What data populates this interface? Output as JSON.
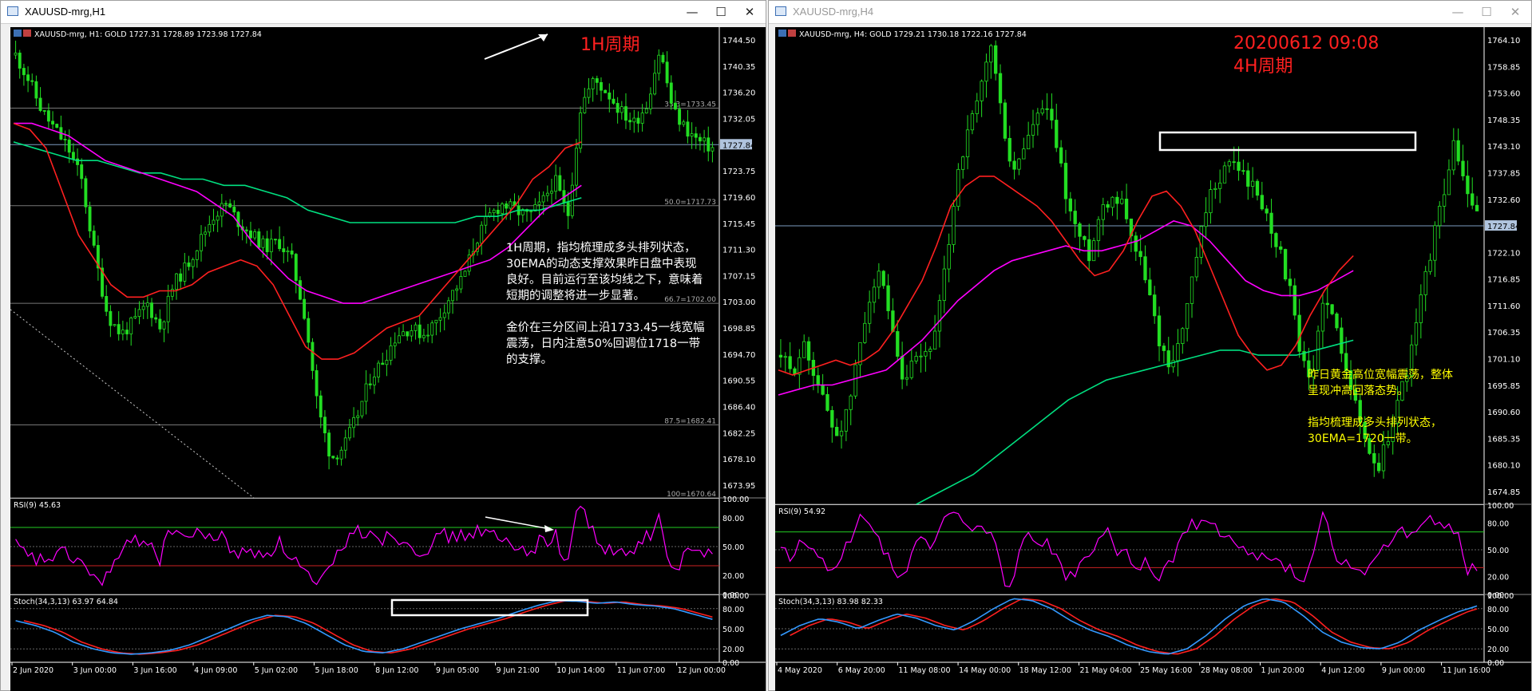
{
  "left_window": {
    "title": "XAUUSD-mrg,H1",
    "info_line": "XAUUSD-mrg, H1:  GOLD   1727.31  1728.89  1723.98  1727.84",
    "annotation_period": "1H周期",
    "comment_lines": [
      "1H周期，指均梳理成多头排列状态，",
      "30EMA的动态支撑效果昨日盘中表现",
      "良好。目前运行至该均线之下，意味着",
      "短期的调整将进一步显著。",
      "",
      "金价在三分区间上沿1733.45一线宽幅",
      "震荡，日内注意50%回调位1718一带",
      "的支撑。"
    ],
    "price_ticks": [
      "1744.50",
      "1740.35",
      "1736.20",
      "1732.05",
      "1727.84",
      "1723.75",
      "1719.60",
      "1715.45",
      "1711.30",
      "1707.15",
      "1703.00",
      "1698.85",
      "1694.70",
      "1690.55",
      "1686.40",
      "1682.25",
      "1678.10",
      "1673.95"
    ],
    "current_price": "1727.84",
    "fib_labels": [
      "33.3=1733.45",
      "50.0=1717.73",
      "66.7=1702.00",
      "87.5=1682.41",
      "100=1670.64"
    ],
    "rsi_label": "RSI(9) 45.63",
    "rsi_ticks": [
      "100.00",
      "80.00",
      "50.00",
      "20.00",
      "0.00"
    ],
    "stoch_label": "Stoch(34,3,13) 63.97 64.84",
    "stoch_ticks": [
      "100.00",
      "80.00",
      "50.00",
      "20.00",
      "0.00"
    ],
    "time_ticks": [
      "2 Jun 2020",
      "3 Jun 00:00",
      "3 Jun 16:00",
      "4 Jun 09:00",
      "5 Jun 02:00",
      "5 Jun 18:00",
      "8 Jun 12:00",
      "9 Jun 05:00",
      "9 Jun 21:00",
      "10 Jun 14:00",
      "11 Jun 07:00",
      "12 Jun 00:00"
    ]
  },
  "right_window": {
    "title": "XAUUSD-mrg,H4",
    "info_line": "XAUUSD-mrg, H4:  GOLD   1729.21  1730.18  1722.16  1727.84",
    "annotation_date": "20200612 09:08",
    "annotation_period": "4H周期",
    "comment_lines": [
      "昨日黄金高位宽幅震荡，整体",
      "呈现冲高回落态势。",
      "",
      "指均梳理成多头排列状态，",
      "30EMA=1720一带。"
    ],
    "price_ticks": [
      "1764.10",
      "1758.85",
      "1753.60",
      "1748.35",
      "1743.10",
      "1737.85",
      "1732.60",
      "1727.84",
      "1722.10",
      "1716.85",
      "1711.60",
      "1706.35",
      "1701.10",
      "1695.85",
      "1690.60",
      "1685.35",
      "1680.10",
      "1674.85"
    ],
    "current_price": "1727.84",
    "rsi_label": "RSI(9) 54.92",
    "rsi_ticks": [
      "100.00",
      "80.00",
      "50.00",
      "20.00",
      "0.00"
    ],
    "stoch_label": "Stoch(34,3,13) 83.98 82.33",
    "stoch_ticks": [
      "100.00",
      "80.00",
      "50.00",
      "20.00",
      "0.00"
    ],
    "time_ticks": [
      "4 May 2020",
      "6 May 20:00",
      "11 May 08:00",
      "14 May 00:00",
      "18 May 12:00",
      "21 May 04:00",
      "25 May 16:00",
      "28 May 08:00",
      "1 Jun 20:00",
      "4 Jun 12:00",
      "9 Jun 00:00",
      "11 Jun 16:00"
    ]
  },
  "buttons": {
    "minimize": "—",
    "maximize": "☐",
    "close": "✕"
  },
  "colors": {
    "bull": "#22dd22",
    "bear": "#22dd22",
    "ema_red": "#ff2020",
    "ema_magenta": "#ff00ff",
    "ema_green": "#00e080",
    "rsi": "#ff00ff",
    "stoch_main": "#3399ff",
    "stoch_signal": "#ff2020",
    "annot_red": "#ff2020",
    "annot_yellow": "#ffff00"
  },
  "chart_data": [
    {
      "type": "candlestick",
      "title": "XAUUSD-mrg,H1",
      "symbol": "XAUUSD-mrg",
      "timeframe": "H1",
      "ohlc_last": {
        "open": 1727.31,
        "high": 1728.89,
        "low": 1723.98,
        "close": 1727.84
      },
      "ylim": [
        1670.64,
        1746.5
      ],
      "close_path": [
        1742,
        1738,
        1733,
        1730,
        1727,
        1722,
        1710,
        1700,
        1697,
        1699,
        1702,
        1698,
        1705,
        1708,
        1712,
        1716,
        1718,
        1715,
        1713,
        1711,
        1712,
        1709,
        1700,
        1685,
        1677,
        1679,
        1684,
        1690,
        1693,
        1697,
        1698,
        1697,
        1699,
        1703,
        1706,
        1712,
        1716,
        1718,
        1717,
        1716,
        1718,
        1722,
        1716,
        1734,
        1738,
        1736,
        1733,
        1731,
        1734,
        1743,
        1733,
        1730,
        1728,
        1727
      ],
      "ema_red": [
        1731,
        1730,
        1727,
        1720,
        1713,
        1709,
        1705,
        1703,
        1703,
        1704,
        1704,
        1705,
        1707,
        1708,
        1709,
        1708,
        1705,
        1700,
        1695,
        1693,
        1693,
        1694,
        1696,
        1698,
        1699,
        1700,
        1703,
        1706,
        1709,
        1712,
        1715,
        1718,
        1722,
        1724,
        1727,
        1728
      ],
      "ema_magenta": [
        1731,
        1731,
        1730,
        1729,
        1727,
        1725,
        1724,
        1723,
        1722,
        1721,
        1720,
        1718,
        1716,
        1712,
        1709,
        1706,
        1704,
        1703,
        1702,
        1702,
        1703,
        1704,
        1705,
        1706,
        1707,
        1708,
        1709,
        1711,
        1714,
        1717,
        1719,
        1721
      ],
      "ema_green": [
        1728,
        1727,
        1726,
        1725,
        1725,
        1724,
        1723,
        1723,
        1722,
        1722,
        1721,
        1721,
        1720,
        1719,
        1717,
        1716,
        1715,
        1715,
        1715,
        1715,
        1715,
        1715,
        1716,
        1716,
        1717,
        1717,
        1718,
        1719
      ],
      "fib_levels": [
        {
          "label": "33.3",
          "value": 1733.45
        },
        {
          "label": "50.0",
          "value": 1717.73
        },
        {
          "label": "66.7",
          "value": 1702.0
        },
        {
          "label": "87.5",
          "value": 1682.41
        },
        {
          "label": "100",
          "value": 1670.64
        }
      ],
      "rsi": {
        "period": 9,
        "last": 45.63,
        "levels": [
          70,
          30
        ]
      },
      "stochastic": {
        "params": [
          34,
          3,
          13
        ],
        "main": 63.97,
        "signal": 64.84
      }
    },
    {
      "type": "candlestick",
      "title": "XAUUSD-mrg,H4",
      "symbol": "XAUUSD-mrg",
      "timeframe": "H4",
      "ohlc_last": {
        "open": 1729.21,
        "high": 1730.18,
        "low": 1722.16,
        "close": 1727.84
      },
      "ylim": [
        1670.0,
        1766.0
      ],
      "close_path": [
        1700,
        1696,
        1702,
        1697,
        1690,
        1684,
        1688,
        1700,
        1712,
        1716,
        1705,
        1694,
        1698,
        1700,
        1704,
        1719,
        1737,
        1745,
        1752,
        1763,
        1748,
        1736,
        1742,
        1747,
        1750,
        1742,
        1730,
        1724,
        1720,
        1730,
        1732,
        1731,
        1722,
        1716,
        1705,
        1698,
        1702,
        1712,
        1724,
        1733,
        1737,
        1739,
        1736,
        1733,
        1728,
        1722,
        1714,
        1700,
        1693,
        1712,
        1707,
        1700,
        1690,
        1682,
        1677,
        1684,
        1692,
        1700,
        1712,
        1723,
        1733,
        1743,
        1733,
        1728
      ],
      "ema_red": [
        1697,
        1696,
        1697,
        1698,
        1699,
        1698,
        1699,
        1701,
        1705,
        1710,
        1715,
        1722,
        1730,
        1734,
        1736,
        1736,
        1734,
        1732,
        1730,
        1727,
        1723,
        1719,
        1716,
        1717,
        1721,
        1727,
        1732,
        1733,
        1730,
        1725,
        1718,
        1711,
        1704,
        1700,
        1697,
        1698,
        1702,
        1708,
        1713,
        1717,
        1720
      ],
      "ema_magenta": [
        1692,
        1693,
        1694,
        1694,
        1695,
        1696,
        1697,
        1700,
        1703,
        1707,
        1711,
        1714,
        1717,
        1719,
        1720,
        1721,
        1722,
        1721,
        1721,
        1722,
        1723,
        1725,
        1727,
        1726,
        1723,
        1719,
        1715,
        1713,
        1712,
        1712,
        1713,
        1715,
        1717
      ],
      "ema_green": [
        1670,
        1672,
        1674,
        1676,
        1679,
        1682,
        1685,
        1688,
        1691,
        1693,
        1695,
        1696,
        1697,
        1698,
        1699,
        1700,
        1701,
        1701,
        1700,
        1700,
        1700,
        1701,
        1702,
        1703
      ],
      "rsi": {
        "period": 9,
        "last": 54.92,
        "levels": [
          70,
          30
        ]
      },
      "stochastic": {
        "params": [
          34,
          3,
          13
        ],
        "main": 83.98,
        "signal": 82.33
      }
    }
  ]
}
